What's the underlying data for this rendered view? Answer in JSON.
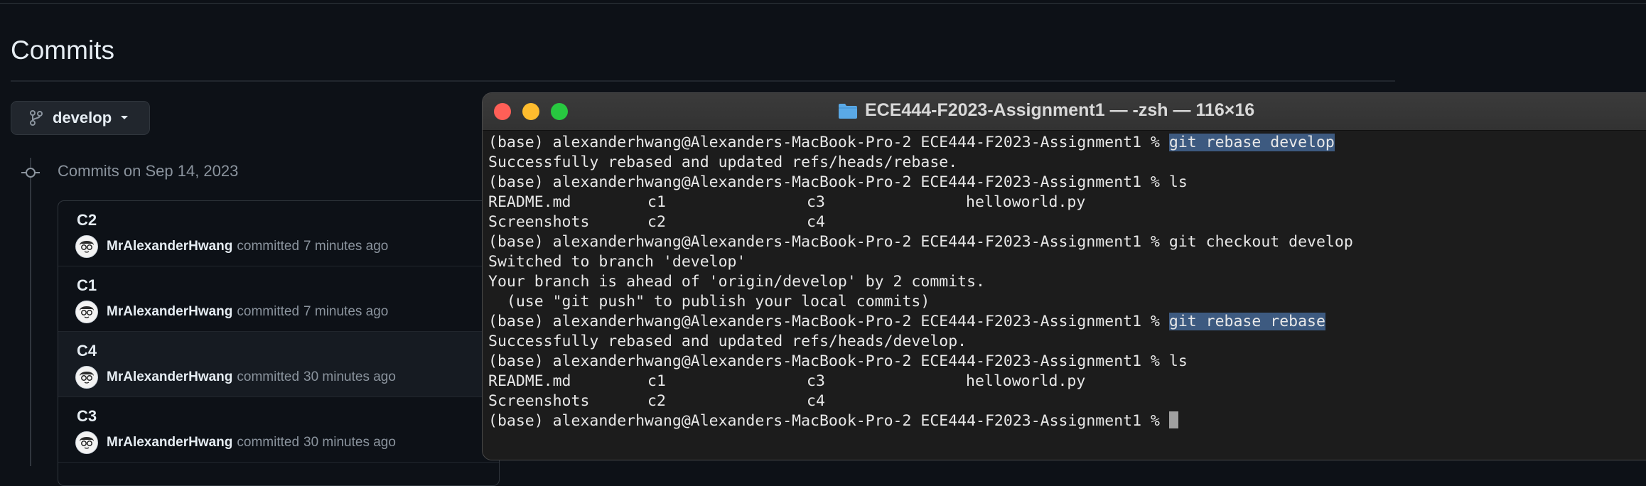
{
  "github": {
    "page_title": "Commits",
    "branch_label": "develop",
    "group_heading": "Commits on Sep 14, 2023",
    "commits": [
      {
        "title": "C2",
        "author": "MrAlexanderHwang",
        "verb": "committed",
        "time": "7 minutes ago"
      },
      {
        "title": "C1",
        "author": "MrAlexanderHwang",
        "verb": "committed",
        "time": "7 minutes ago"
      },
      {
        "title": "C4",
        "author": "MrAlexanderHwang",
        "verb": "committed",
        "time": "30 minutes ago"
      },
      {
        "title": "C3",
        "author": "MrAlexanderHwang",
        "verb": "committed",
        "time": "30 minutes ago"
      }
    ]
  },
  "terminal": {
    "title": "ECE444-F2023-Assignment1 — -zsh — 116×16",
    "prompt": "(base) alexanderhwang@Alexanders-MacBook-Pro-2 ECE444-F2023-Assignment1 % ",
    "cmd1": "git rebase develop",
    "out1": "Successfully rebased and updated refs/heads/rebase.",
    "cmd2": "ls",
    "ls1": {
      "a": "README.md",
      "b": "c1",
      "c": "c3",
      "d": "helloworld.py"
    },
    "ls2": {
      "a": "Screenshots",
      "b": "c2",
      "c": "c4"
    },
    "cmd3": "git checkout develop",
    "out3a": "Switched to branch 'develop'",
    "out3b": "Your branch is ahead of 'origin/develop' by 2 commits.",
    "out3c": "  (use \"git push\" to publish your local commits)",
    "cmd4": "git rebase rebase",
    "out4": "Successfully rebased and updated refs/heads/develop.",
    "cmd5": "ls"
  },
  "colors": {
    "page_bg": "#0d1117",
    "terminal_bg": "#1c1c1c",
    "selection": "#3d5a80",
    "folder_icon": "#5aa9e6"
  }
}
